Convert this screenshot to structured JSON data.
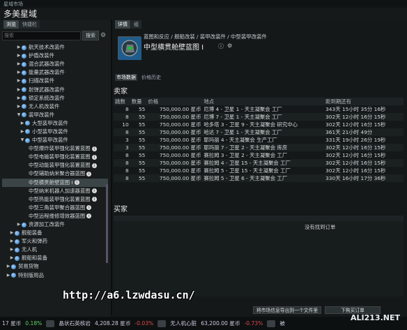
{
  "window": {
    "titlebar": "星域市场",
    "app_title": "多美星域"
  },
  "left_tabs": [
    "浏览",
    "快捷栏"
  ],
  "search": {
    "placeholder": "搜索",
    "button": "搜索"
  },
  "tree": [
    {
      "label": "航天技术改装件",
      "indent": 4,
      "tri": "▶",
      "bullet": true
    },
    {
      "label": "护盾改装件",
      "indent": 4,
      "tri": "▶",
      "bullet": true
    },
    {
      "label": "混合武器改装件",
      "indent": 4,
      "tri": "▶",
      "bullet": true
    },
    {
      "label": "能量武器改装件",
      "indent": 4,
      "tri": "▶",
      "bullet": true
    },
    {
      "label": "扫描改装件",
      "indent": 4,
      "tri": "▶",
      "bullet": true
    },
    {
      "label": "射弹武器改装件",
      "indent": 4,
      "tri": "▶",
      "bullet": true
    },
    {
      "label": "锁定系统改装件",
      "indent": 4,
      "tri": "▶",
      "bullet": true
    },
    {
      "label": "无人机改装件",
      "indent": 4,
      "tri": "▶",
      "bullet": true
    },
    {
      "label": "装甲改装件",
      "indent": 4,
      "tri": "▼",
      "bullet": true
    },
    {
      "label": "大型装甲改装件",
      "indent": 5,
      "tri": "▶",
      "bullet": true
    },
    {
      "label": "小型装甲改装件",
      "indent": 5,
      "tri": "▶",
      "bullet": true
    },
    {
      "label": "中型装甲改装件",
      "indent": 5,
      "tri": "▼",
      "bullet": true
    },
    {
      "label": "中型爆炸装甲强化装置蓝图",
      "indent": 6,
      "tri": "",
      "bullet": false,
      "info": true
    },
    {
      "label": "中型电磁装甲强化装置蓝图",
      "indent": 6,
      "tri": "",
      "bullet": false,
      "info": true
    },
    {
      "label": "中型动能装甲强化装置蓝图",
      "indent": 6,
      "tri": "",
      "bullet": false,
      "info": true
    },
    {
      "label": "中型辅助纳米聚合器蓝图",
      "indent": 6,
      "tri": "",
      "bullet": false,
      "info": true
    },
    {
      "label": "中型横贯舱壁蓝图 I",
      "indent": 6,
      "tri": "",
      "bullet": false,
      "info": true,
      "selected": true
    },
    {
      "label": "中型纳米机器人加速器蓝图",
      "indent": 6,
      "tri": "",
      "bullet": false,
      "info": true
    },
    {
      "label": "中型热能装甲强化装置蓝图",
      "indent": 6,
      "tri": "",
      "bullet": false,
      "info": true
    },
    {
      "label": "中型三角装甲聚合器蓝图",
      "indent": 6,
      "tri": "",
      "bullet": false,
      "info": true
    },
    {
      "label": "中型远程维修增效器蓝图",
      "indent": 6,
      "tri": "",
      "bullet": false,
      "info": true
    },
    {
      "label": "资源加工改装件",
      "indent": 4,
      "tri": "▶",
      "bullet": true
    },
    {
      "label": "舰船装备",
      "indent": 2,
      "tri": "▶",
      "bullet": true
    },
    {
      "label": "军火和弹药",
      "indent": 2,
      "tri": "▶",
      "bullet": true
    },
    {
      "label": "无人机",
      "indent": 2,
      "tri": "▶",
      "bullet": true
    },
    {
      "label": "舰船和装备",
      "indent": 2,
      "tri": "▶",
      "bullet": true
    },
    {
      "label": "贸易货物",
      "indent": 1,
      "tri": "▶",
      "bullet": true
    },
    {
      "label": "特别版用品",
      "indent": 1,
      "tri": "▶",
      "bullet": true
    }
  ],
  "right_tabs": [
    "详情",
    "组"
  ],
  "breadcrumb": "蓝图和反应 / 舰船改装 / 装甲改装件 / 中型装甲改装件",
  "item": {
    "name": "中型横贯舱壁蓝图 I"
  },
  "sub_tabs": [
    "市场数据",
    "价格历史"
  ],
  "sellers": {
    "title": "卖家",
    "columns": [
      "跳数",
      "数量",
      "价格",
      "地点",
      "距到期还有"
    ],
    "rows": [
      [
        "8",
        "55",
        "750,000.00 星币",
        "厄博 4 - 卫星 1 - 天主凝聚会 工厂",
        "343天 15小时 35分 16秒"
      ],
      [
        "8",
        "55",
        "750,000.00 星币",
        "厄博 7 - 卫星 1 - 天主凝聚会 工厂",
        "302天 12小时 16分 15秒"
      ],
      [
        "10",
        "55",
        "750,000.00 星币",
        "哈多塔 3 - 卫星 9 - 天主凝聚会 研究中心",
        "302天 12小时 16分 15秒"
      ],
      [
        "8",
        "55",
        "750,000.00 星币",
        "哈达 7 - 卫星 1 - 天主凝聚会 工厂",
        "361天 21小时 49分"
      ],
      [
        "3",
        "55",
        "750,000.00 星币",
        "耶玛丽 4 - 天主凝聚会 生产工厂",
        "331天 19小时 26分 19秒"
      ],
      [
        "3",
        "55",
        "750,000.00 星币",
        "耶玛丽 7 - 卫星 2 - 天主凝聚会 库房",
        "302天 12小时 16分 15秒"
      ],
      [
        "8",
        "55",
        "750,000.00 星币",
        "赛拉姆 3 - 卫星 2 - 天主凝聚会 工厂",
        "302天 12小时 16分 15秒"
      ],
      [
        "8",
        "55",
        "750,000.00 星币",
        "赛拉姆 4 - 卫星 15 - 天主凝聚会 工厂",
        "302天 12小时 16分 15秒"
      ],
      [
        "8",
        "55",
        "750,000.00 星币",
        "赛拉姆 5 - 卫星 15 - 天主凝聚会 工厂",
        "302天 12小时 16分 15秒"
      ],
      [
        "8",
        "55",
        "750,000.00 星币",
        "赛拉姆 5 - 卫星 6 - 天主凝聚会 工厂",
        "330天 16小时 17分 36秒"
      ]
    ]
  },
  "buyers": {
    "title": "买家",
    "empty": "没有找到订单"
  },
  "buttons": {
    "export": "将市场信息导出到一个文件里",
    "buy": "下购买订单"
  },
  "status": {
    "isk": "17 星币",
    "pct1": "0.18%",
    "t1": "晶状石英核岩",
    "v1": "4,208.28 星币",
    "p1": "-0.03%",
    "t2": "无人机心脏",
    "v2": "63,200.00 星币",
    "p2": "-0.73%",
    "t3": "被"
  },
  "watermark": "http://a6.lzwdasu.cn/",
  "logo": "ALI213.NET"
}
